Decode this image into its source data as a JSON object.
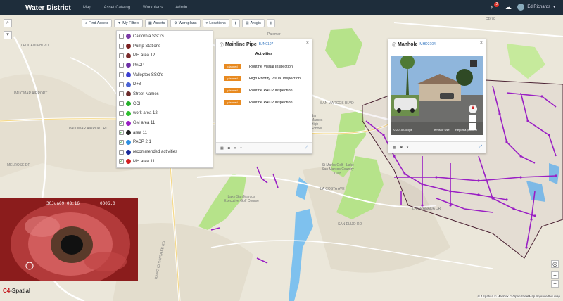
{
  "app": {
    "title": "Water District"
  },
  "nav": [
    "Map",
    "Asset Catalog",
    "Workplans",
    "Admin"
  ],
  "header": {
    "notification_count": "2",
    "user_name": "Ed Richards"
  },
  "toolbar": {
    "find_assets": "Find Assets",
    "my_filters": "My Filters",
    "assets": "Assets",
    "workplans": "Workplans",
    "locations": "Locations",
    "arcgis": "Arcgis"
  },
  "layers": [
    {
      "name": "California SSO's",
      "checked": false,
      "color": "#7b3aa8"
    },
    {
      "name": "Pump Stations",
      "checked": false,
      "color": "#7a1f1f"
    },
    {
      "name": "MH area 12",
      "checked": false,
      "color": "#7a2a2a"
    },
    {
      "name": "PACP",
      "checked": false,
      "color": "#6d2fa6"
    },
    {
      "name": "Valleptox SSO's",
      "checked": false,
      "color": "#3b3fd1"
    },
    {
      "name": "D+8",
      "checked": false,
      "color": "#4a63d4"
    },
    {
      "name": "Street Names",
      "checked": false,
      "color": "#6b2a2a"
    },
    {
      "name": "CCI",
      "checked": false,
      "color": "#26b02a"
    },
    {
      "name": "work area 12",
      "checked": false,
      "color": "#2fbf2f"
    },
    {
      "name": "GM area 11",
      "checked": true,
      "color": "#9a1fc4"
    },
    {
      "name": "area 11",
      "checked": true,
      "color": "#222222"
    },
    {
      "name": "PACP 2.1",
      "checked": true,
      "color": "#2f8fe0"
    },
    {
      "name": "recommended activities",
      "checked": false,
      "color": "#1a2a9a"
    },
    {
      "name": "MH area 11",
      "checked": true,
      "color": "#d32020"
    }
  ],
  "pipe_popup": {
    "title": "Mainline Pipe",
    "id": "BJN0107",
    "heading": "Activities",
    "activities": [
      {
        "status": "planned",
        "name": "Routine Visual Inspection"
      },
      {
        "status": "planned",
        "name": "High Priority Visual Inspection"
      },
      {
        "status": "planned",
        "name": "Routine PACP Inspection"
      },
      {
        "status": "planned",
        "name": "Routine PACP Inspection"
      }
    ]
  },
  "manhole_popup": {
    "title": "Manhole",
    "id": "MHD2104",
    "copyright": "© 2015 Google",
    "terms": "Terms of Use",
    "report": "Report a problem"
  },
  "cctv": {
    "timestamp": "30Jun09 08:16",
    "counter": "0006.0"
  },
  "footer": {
    "logo_a": "C4",
    "logo_b": "-Spatial",
    "attribution": "© 1Spatial, © Mapbox © OpenStreetMap Improve this map"
  },
  "map_labels": {
    "palomar_airport": "PALOMAR AIRPORT RD",
    "palomar_airport2": "PALOMAR AIRPORT",
    "san_marcos_blvd": "SAN MARCOS BLVD",
    "rancho_santa_fe": "RANCHO SANTA FE RD",
    "la_costa_ave": "LA COSTA AVE",
    "san_elijo": "SAN ELIJO RD",
    "melrose": "MELROSE DR",
    "leucadia": "LEUCADIA BLVD",
    "lake_san_marcos": "Lake San Marcos Executive Golf Course",
    "st_marks": "St Marks Golf - Lake San Marcos Country Club",
    "palomar": "Palomar",
    "san_marcos_hs": "San Marcos High School",
    "granada": "LA GRANADA DR",
    "cb78": "CB 78"
  },
  "colors": {
    "accent": "#1e2d3b",
    "planned": "#e88a20",
    "link": "#3b7bc2",
    "pipe": "#9a1fc4"
  }
}
